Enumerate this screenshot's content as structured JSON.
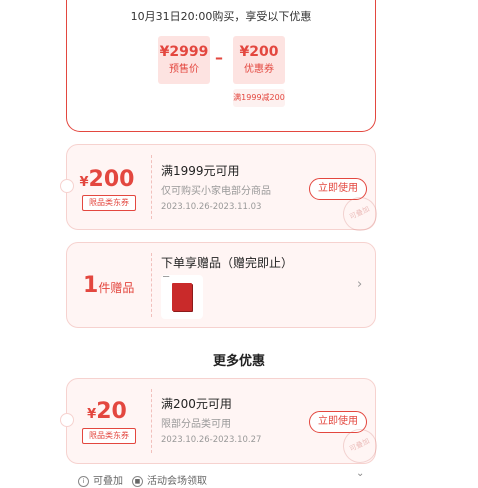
{
  "top_card": {
    "note": "10月31日20:00购买，享受以下优惠",
    "presale_price": "¥2999",
    "presale_label": "预售价",
    "coupon_price": "¥200",
    "coupon_label": "优惠券",
    "condition_tag": "满1999减200"
  },
  "coupons": [
    {
      "yen": "¥",
      "amount": "200",
      "tag": "限品类东券",
      "title": "满1999元可用",
      "desc": "仅可购买小家电部分商品",
      "date": "2023.10.26-2023.11.03",
      "button": "立即使用",
      "stamp": "可叠加"
    },
    {
      "yen": "¥",
      "amount": "20",
      "tag": "限品类东券",
      "title": "满200元可用",
      "desc": "限部分品类可用",
      "date": "2023.10.26-2023.10.27",
      "button": "立即使用",
      "stamp": "可叠加"
    }
  ],
  "gift": {
    "count": "1",
    "unit": "件赠品",
    "title": "下单享赠品（赠完即止）"
  },
  "section_more": "更多优惠",
  "footer": {
    "stackable": "可叠加",
    "activity": "活动会场领取"
  },
  "colors": {
    "accent": "#e3473f",
    "card_bg": "#fff5f4"
  }
}
